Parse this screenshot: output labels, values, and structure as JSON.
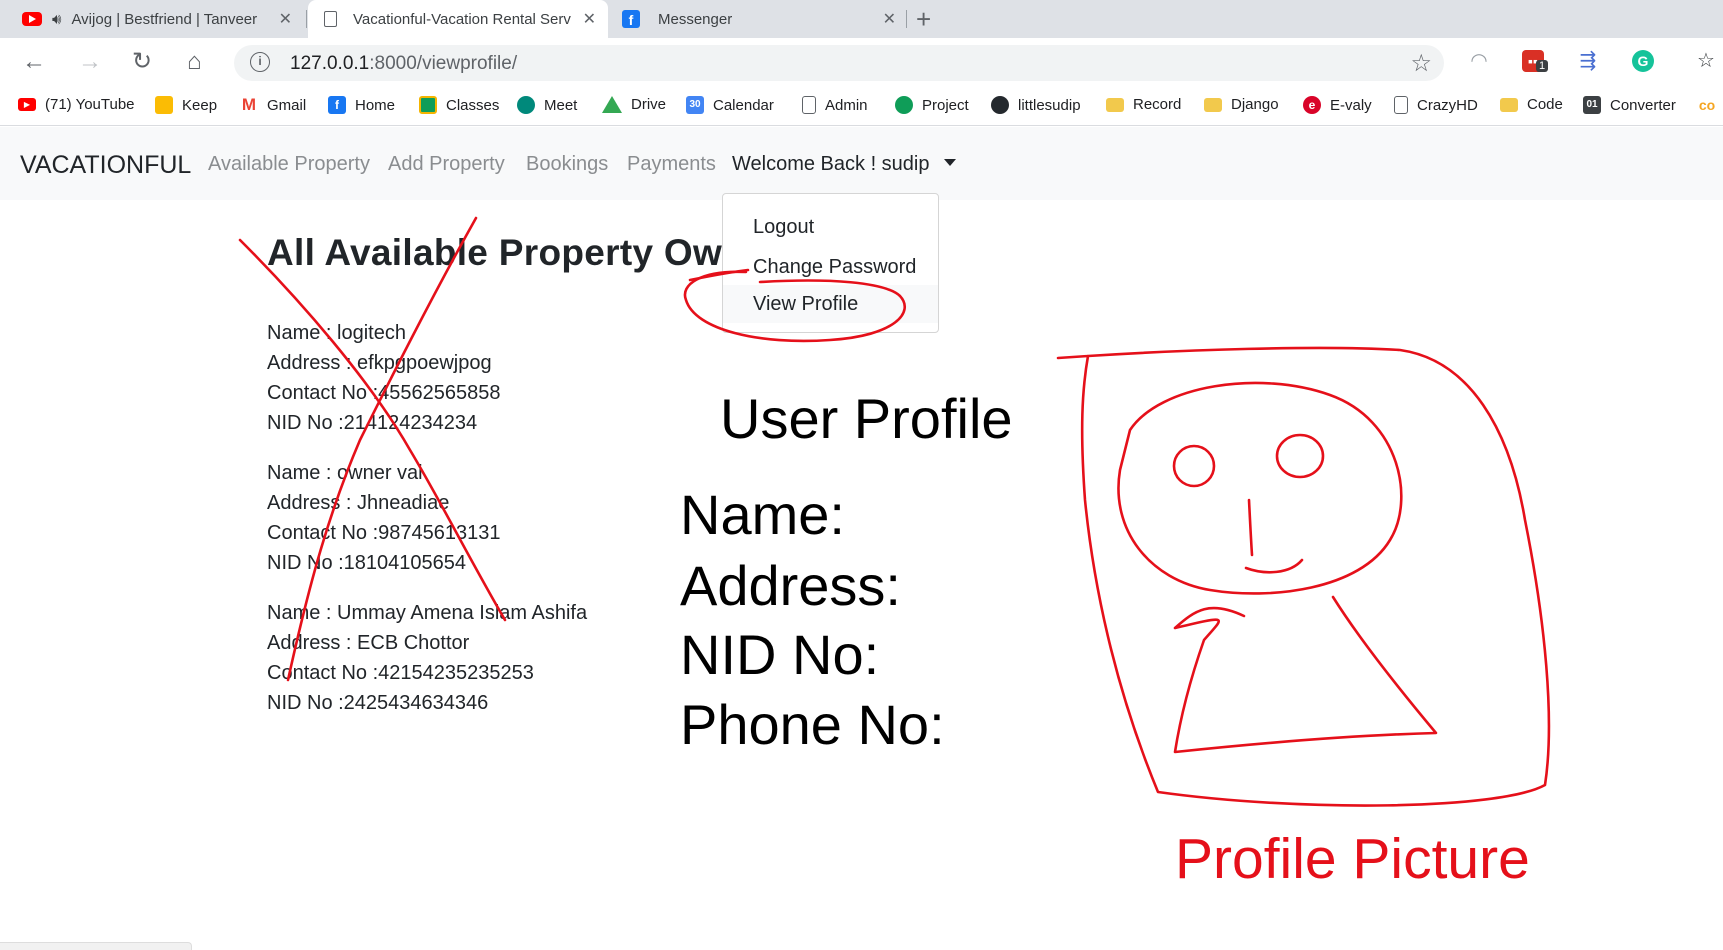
{
  "browser": {
    "tabs": [
      {
        "title": "Avijog | Bestfriend | Tanveer",
        "icon": "youtube-icon",
        "audio": true
      },
      {
        "title": "Vacationful-Vacation Rental Serv",
        "icon": "page-icon",
        "active": true
      },
      {
        "title": "Messenger",
        "icon": "facebook-icon"
      }
    ],
    "address": {
      "host": "127.0.0.1",
      "path": ":8000/viewprofile/"
    },
    "extension_badge": "1",
    "bookmarks": [
      {
        "label": "(71) YouTube",
        "icon": "youtube-icon",
        "color": "#ff0000"
      },
      {
        "label": "Keep",
        "icon": "keep-icon",
        "color": "#fbbc04"
      },
      {
        "label": "Gmail",
        "icon": "gmail-icon",
        "color": "#ea4335"
      },
      {
        "label": "Home",
        "icon": "facebook-icon",
        "color": "#1877f2"
      },
      {
        "label": "Classes",
        "icon": "classroom-icon",
        "color": "#0f9d58"
      },
      {
        "label": "Meet",
        "icon": "meet-icon",
        "color": "#00897b"
      },
      {
        "label": "Drive",
        "icon": "drive-icon",
        "color": "#fbbc04"
      },
      {
        "label": "Calendar",
        "icon": "calendar-icon",
        "color": "#4285f4"
      },
      {
        "label": "Admin",
        "icon": "page-icon",
        "color": "#5f6368"
      },
      {
        "label": "Project",
        "icon": "hangouts-icon",
        "color": "#0f9d58"
      },
      {
        "label": "littlesudip",
        "icon": "github-icon",
        "color": "#24292e"
      },
      {
        "label": "Record",
        "icon": "folder-icon",
        "color": "#f2c94c"
      },
      {
        "label": "Django",
        "icon": "folder-icon",
        "color": "#f2c94c"
      },
      {
        "label": "E-valy",
        "icon": "evaly-icon",
        "color": "#d90429"
      },
      {
        "label": "CrazyHD",
        "icon": "page-icon",
        "color": "#5f6368"
      },
      {
        "label": "Code",
        "icon": "folder-icon",
        "color": "#f2c94c"
      },
      {
        "label": "Converter",
        "icon": "converter-icon",
        "color": "#3c4043"
      },
      {
        "label": "",
        "icon": "coursera-icon",
        "color": "#f5a623"
      }
    ]
  },
  "navbar": {
    "brand": "VACATIONFUL",
    "links": [
      "Available Property",
      "Add Property",
      "Bookings",
      "Payments"
    ],
    "user_menu": "Welcome Back ! sudip"
  },
  "dropdown": {
    "items": [
      "Logout",
      "Change Password",
      "View Profile"
    ]
  },
  "owners": {
    "title": "All Available Property Ow",
    "entries": [
      {
        "name": "Name : logitech",
        "address": "Address : efkpgpoewjpog",
        "contact": "Contact No :45562565858",
        "nid": "NID No :214124234234"
      },
      {
        "name": "Name : owner vai",
        "address": "Address : Jhneadiae",
        "contact": "Contact No :98745613131",
        "nid": "NID No :18104105654"
      },
      {
        "name": "Name : Ummay Amena Islam Ashifa",
        "address": "Address : ECB Chottor",
        "contact": "Contact No :42154235235253",
        "nid": "NID No :2425434634346"
      }
    ]
  },
  "mockup": {
    "title": "User Profile",
    "fields": [
      "Name:",
      "Address:",
      "NID No:",
      "Phone No:"
    ],
    "picture_label": "Profile Picture",
    "annotation_color": "#e5101a"
  }
}
